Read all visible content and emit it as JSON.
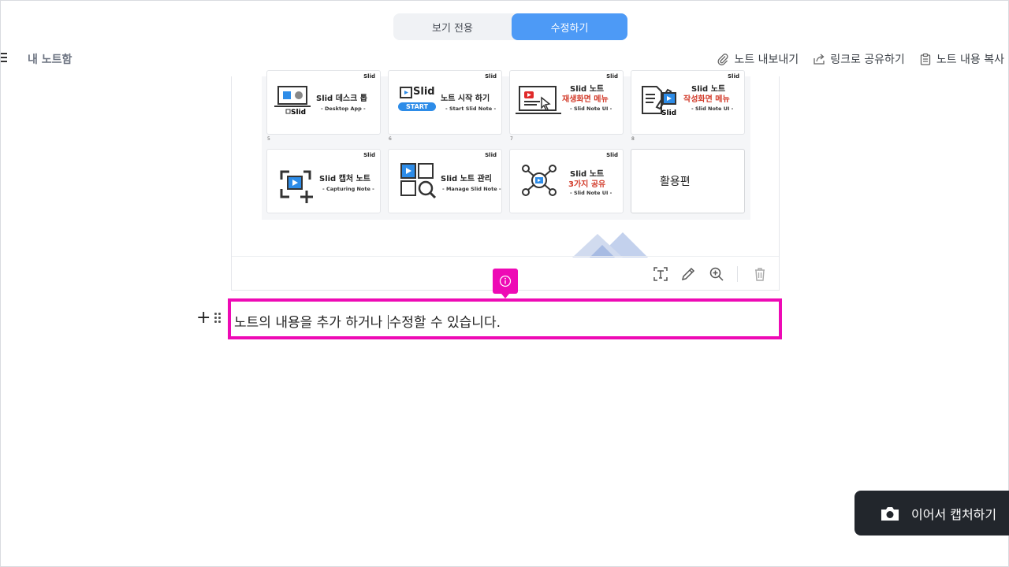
{
  "mode_toggle": {
    "view_only": "보기 전용",
    "edit": "수정하기",
    "active": "edit"
  },
  "header": {
    "notebook_title": "내 노트함",
    "actions": {
      "export": "노트 내보내기",
      "share_link": "링크로 공유하기",
      "copy_content": "노트 내용 복사"
    }
  },
  "slides": {
    "brand": "Slid",
    "cards": [
      {
        "title": "Slid 데스크 톱",
        "sub": "- Desktop App -",
        "num": "5"
      },
      {
        "title": "노트 시작 하기",
        "sub": "- Start Slid Note -",
        "badge": "START",
        "logo": "Slid",
        "num": "6"
      },
      {
        "title": "Slid 노트",
        "title2": "재생화면 메뉴",
        "sub": "- Slid Note UI -",
        "num": "7"
      },
      {
        "title": "Slid 노트",
        "title2": "작성화면 메뉴",
        "sub": "- Slid Note UI -",
        "num": "8"
      },
      {
        "title": "Slid 캡처 노트",
        "sub": "- Capturing Note -"
      },
      {
        "title": "Slid 노트 관리",
        "sub": "- Manage Slid Note -"
      },
      {
        "title": "Slid 노트",
        "title2": "3가지 공유",
        "sub": "- Slid Note UI -"
      },
      {
        "title": "활용편"
      }
    ]
  },
  "editor": {
    "text_before_caret": "노트의 내용을 추가 하거나 ",
    "text_after_caret": "수정할 수 있습니다.",
    "add_symbol": "+"
  },
  "capture_button": {
    "label": "이어서 캡처하기"
  },
  "colors": {
    "accent": "#4d9af6",
    "highlight": "#ee0ab5",
    "dark_button": "#22262c"
  }
}
